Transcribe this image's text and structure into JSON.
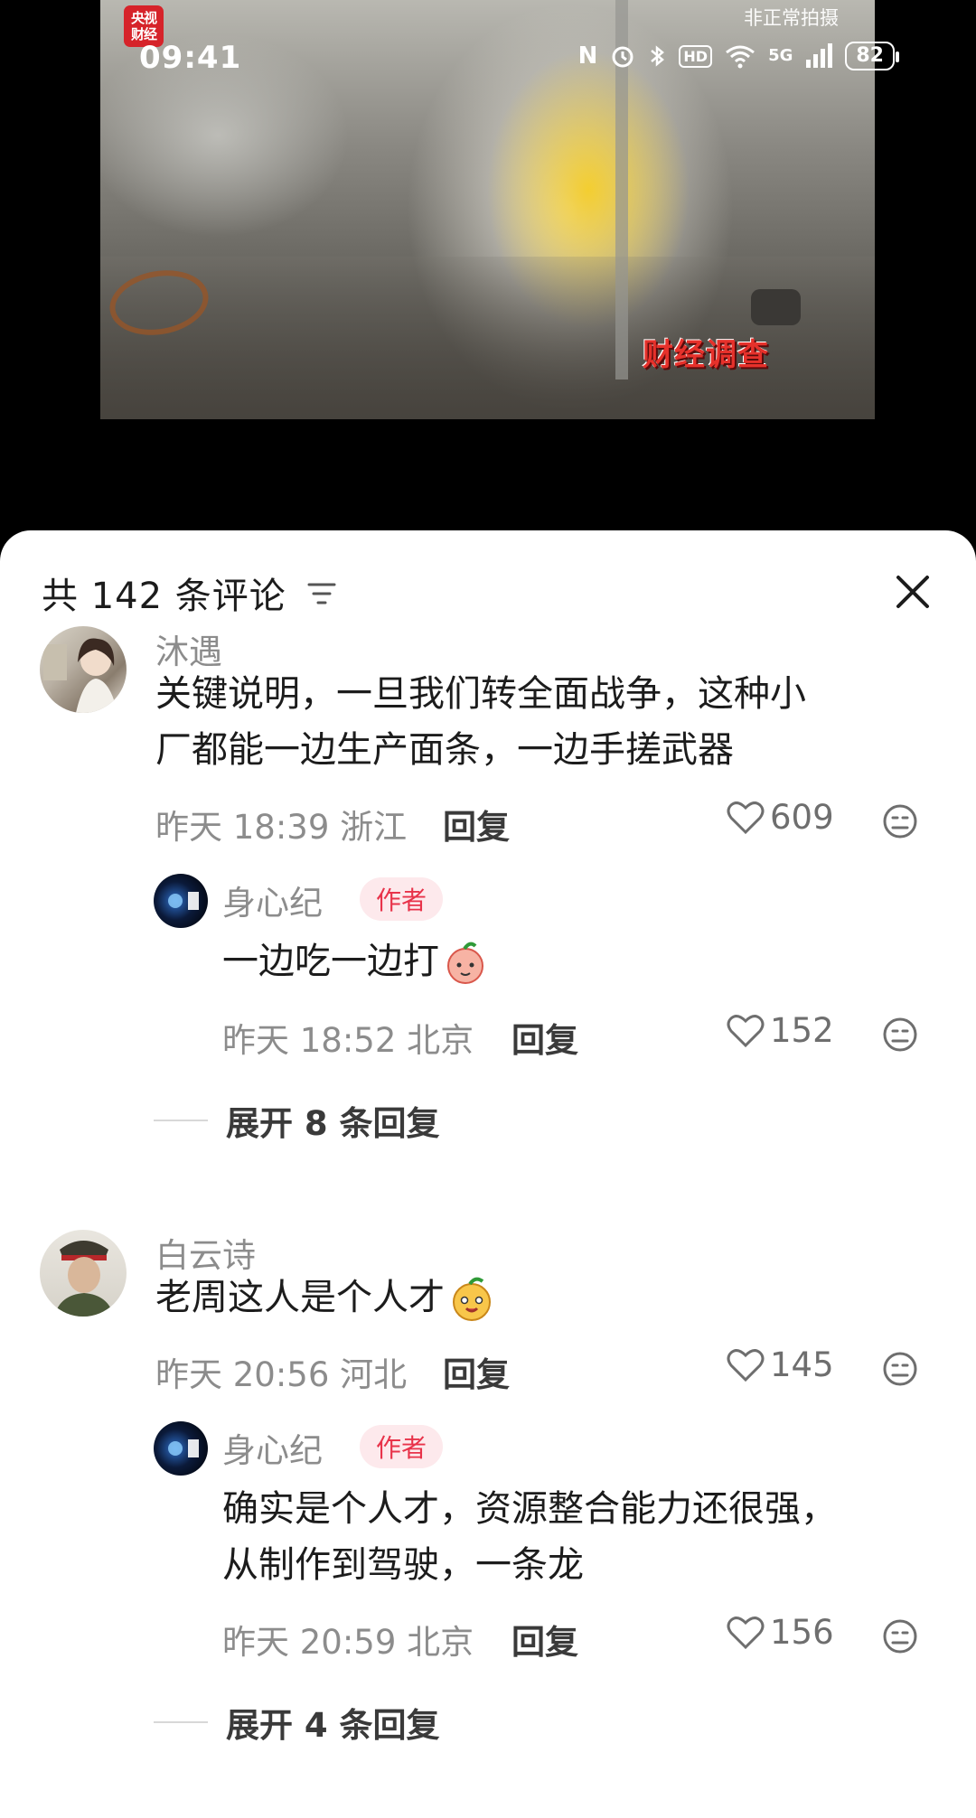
{
  "video": {
    "logo_line1": "央视",
    "logo_line2": "财经",
    "watermark": "财经调查",
    "note": "非正常拍摄"
  },
  "status_bar": {
    "time": "09:41",
    "network": "5G",
    "hd_label": "HD",
    "battery": "82"
  },
  "comments_panel": {
    "title": "共 142 条评论"
  },
  "comments": [
    {
      "username": "沐遇",
      "text_line1": "关键说明，一旦我们转全面战争，这种小",
      "text_line2": "厂都能一边生产面条，一边手搓武器",
      "meta": "昨天 18:39 浙江",
      "reply_label": "回复",
      "likes": "609",
      "replies": [
        {
          "username": "身心纪",
          "tag": "作者",
          "text": "一边吃一边打",
          "meta": "昨天 18:52 北京",
          "reply_label": "回复",
          "likes": "152"
        }
      ],
      "expand_label": "展开 8 条回复"
    },
    {
      "username": "白云诗",
      "text_line1": "老周这人是个人才",
      "meta": "昨天 20:56 河北",
      "reply_label": "回复",
      "likes": "145",
      "replies": [
        {
          "username": "身心纪",
          "tag": "作者",
          "text_line1": "确实是个人才，资源整合能力还很强，",
          "text_line2": "从制作到驾驶，一条龙",
          "meta": "昨天 20:59 北京",
          "reply_label": "回复",
          "likes": "156"
        }
      ],
      "expand_label": "展开 4 条回复"
    }
  ],
  "icons": {
    "filter": "filter-icon",
    "close": "close-icon",
    "like": "heart-outline-icon",
    "dislike": "meh-face-icon"
  },
  "colors": {
    "author_tag": "#e8334a",
    "author_tag_bg": "#fde9ec",
    "meta_text": "#8c8c8c"
  }
}
